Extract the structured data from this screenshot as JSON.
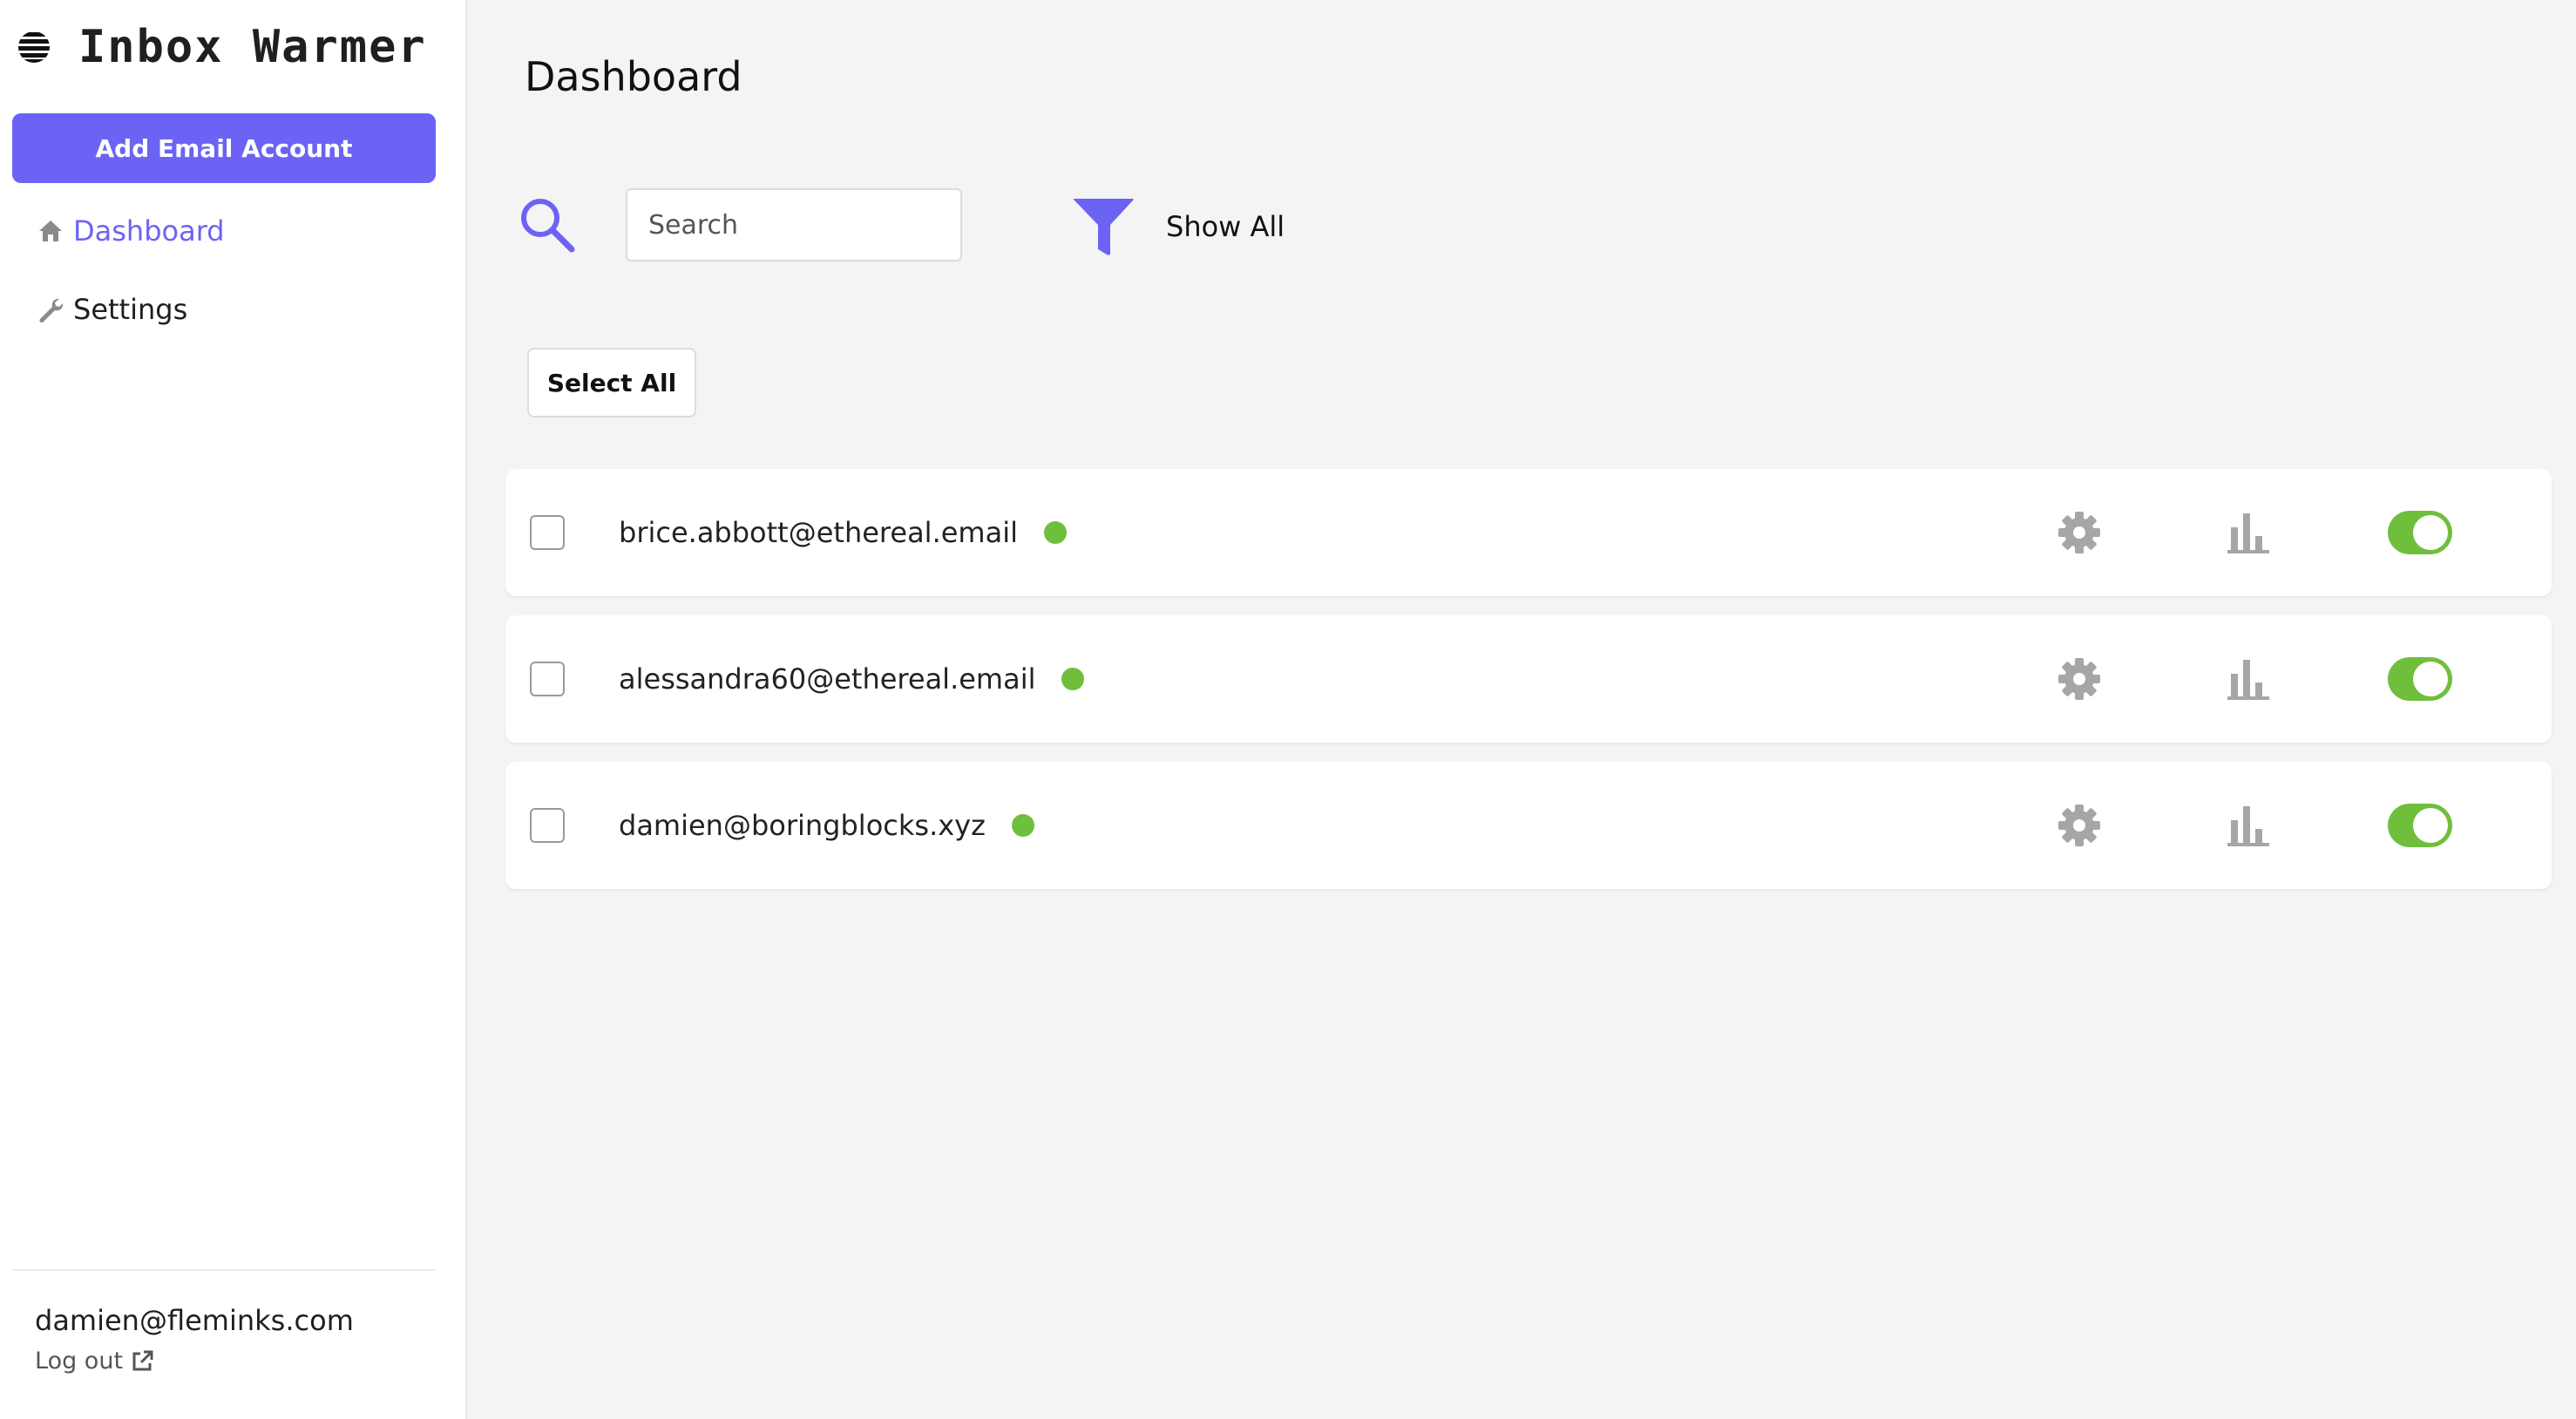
{
  "app": {
    "title": "Inbox Warmer"
  },
  "sidebar": {
    "add_button_label": "Add Email Account",
    "nav": [
      {
        "label": "Dashboard",
        "icon": "home-icon",
        "active": true
      },
      {
        "label": "Settings",
        "icon": "wrench-icon",
        "active": false
      }
    ],
    "user_email": "damien@fleminks.com",
    "logout_label": "Log out"
  },
  "main": {
    "page_title": "Dashboard",
    "search": {
      "placeholder": "Search",
      "value": ""
    },
    "filter_label": "Show All",
    "select_all_label": "Select All",
    "accounts": [
      {
        "email": "brice.abbott@ethereal.email",
        "status": "active",
        "enabled": true
      },
      {
        "email": "alessandra60@ethereal.email",
        "status": "active",
        "enabled": true
      },
      {
        "email": "damien@boringblocks.xyz",
        "status": "active",
        "enabled": true
      }
    ]
  },
  "colors": {
    "accent": "#6c63f5",
    "status_green": "#6fbf3d",
    "background": "#f4f4f4",
    "icon_gray": "#a6a6a6"
  }
}
